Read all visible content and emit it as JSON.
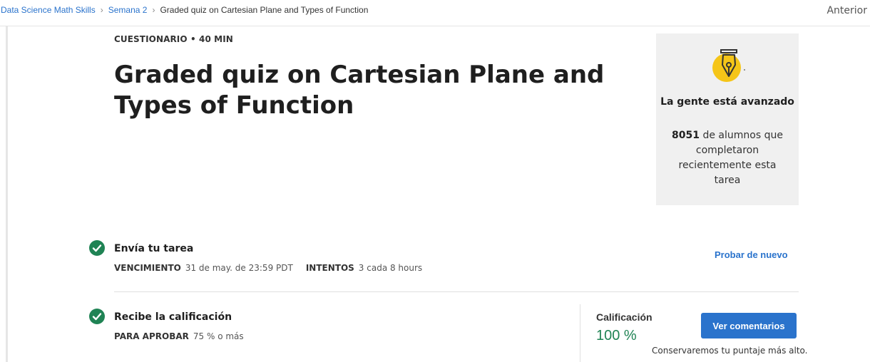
{
  "breadcrumb": {
    "items": [
      "Data Science Math Skills",
      "Semana 2"
    ],
    "current": "Graded quiz on Cartesian Plane and Types of Function"
  },
  "nav": {
    "previous_label": "Anterior"
  },
  "quiz": {
    "meta": "CUESTIONARIO • 40 MIN",
    "title": "Graded quiz on Cartesian Plane and Types of Function"
  },
  "card": {
    "icon": "pen-nib-icon",
    "heading": "La gente está avanzado",
    "learners_count": "8051",
    "learners_text": " de alumnos que completaron recientemente esta tarea"
  },
  "steps": [
    {
      "title": "Envía tu tarea",
      "due_label": "VENCIMIENTO",
      "due_value": "31 de may. de 23:59 PDT",
      "attempts_label": "INTENTOS",
      "attempts_value": "3 cada 8 hours",
      "action_label": "Probar de nuevo"
    },
    {
      "title": "Recibe la calificación",
      "pass_label": "PARA APROBAR",
      "pass_value": "75 % o más",
      "grade_label": "Calificación",
      "grade_value": "100 %",
      "feedback_button": "Ver comentarios",
      "note": "Conservaremos tu puntaje más alto."
    }
  ],
  "colors": {
    "accent": "#2a73cc",
    "success": "#1f8354",
    "card_bg": "#f0f0f0",
    "icon_yellow": "#f5c518"
  }
}
